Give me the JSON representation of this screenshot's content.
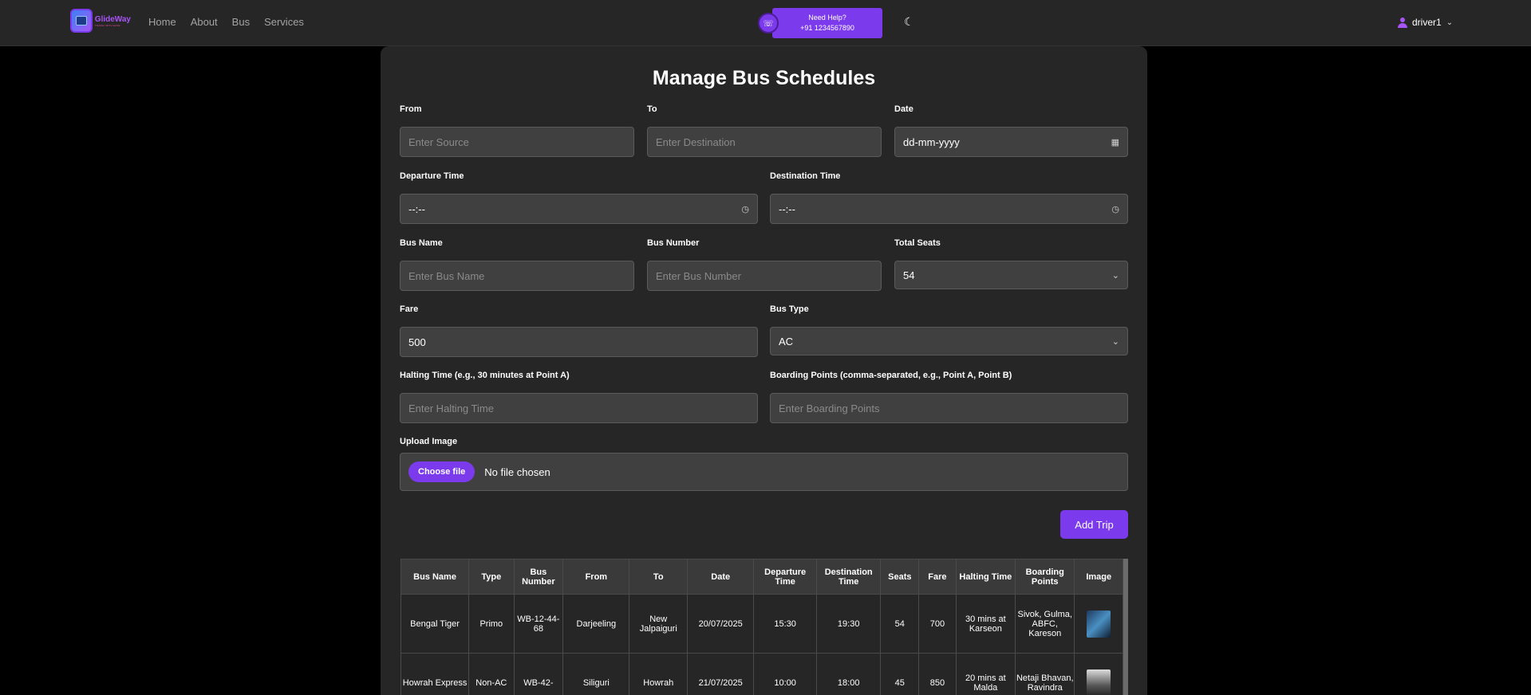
{
  "nav": {
    "logo_name": "GlideWay",
    "logo_tagline": "TRAVEL WITH EASE",
    "links": [
      "Home",
      "About",
      "Bus",
      "Services"
    ],
    "help_title": "Need Help?",
    "help_phone": "+91 1234567890",
    "username": "driver1"
  },
  "form": {
    "title": "Manage Bus Schedules",
    "from": {
      "label": "From",
      "placeholder": "Enter Source"
    },
    "to": {
      "label": "To",
      "placeholder": "Enter Destination"
    },
    "date": {
      "label": "Date",
      "value": "dd-mm-yyyy"
    },
    "departure": {
      "label": "Departure Time",
      "value": "--:--"
    },
    "destination_time": {
      "label": "Destination Time",
      "value": "--:--"
    },
    "bus_name": {
      "label": "Bus Name",
      "placeholder": "Enter Bus Name"
    },
    "bus_number": {
      "label": "Bus Number",
      "placeholder": "Enter Bus Number"
    },
    "total_seats": {
      "label": "Total Seats",
      "value": "54"
    },
    "fare": {
      "label": "Fare",
      "value": "500"
    },
    "bus_type": {
      "label": "Bus Type",
      "value": "AC"
    },
    "halting": {
      "label": "Halting Time (e.g., 30 minutes at Point A)",
      "placeholder": "Enter Halting Time"
    },
    "boarding": {
      "label": "Boarding Points (comma-separated, e.g., Point A, Point B)",
      "placeholder": "Enter Boarding Points"
    },
    "upload": {
      "label": "Upload Image",
      "button": "Choose file",
      "status": "No file chosen"
    },
    "add_button": "Add Trip"
  },
  "table": {
    "headers": [
      "Bus Name",
      "Type",
      "Bus Number",
      "From",
      "To",
      "Date",
      "Departure Time",
      "Destination Time",
      "Seats",
      "Fare",
      "Halting Time",
      "Boarding Points",
      "Image"
    ],
    "rows": [
      [
        "Bengal Tiger",
        "Primo",
        "WB-12-44-68",
        "Darjeeling",
        "New Jalpaiguri",
        "20/07/2025",
        "15:30",
        "19:30",
        "54",
        "700",
        "30 mins at Karseon",
        "Sivok, Gulma, ABFC, Kareson",
        ""
      ],
      [
        "Howrah Express",
        "Non-AC",
        "WB-42-",
        "Siliguri",
        "Howrah",
        "21/07/2025",
        "10:00",
        "18:00",
        "45",
        "850",
        "20 mins at Malda",
        "Netaji Bhavan, Ravindra",
        ""
      ]
    ]
  }
}
